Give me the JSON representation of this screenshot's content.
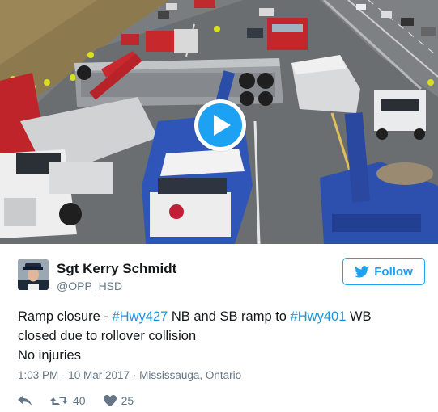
{
  "author": {
    "name": "Sgt Kerry Schmidt",
    "handle": "@OPP_HSD"
  },
  "follow_button": {
    "label": "Follow",
    "icon": "twitter-bird-icon"
  },
  "tweet": {
    "line1_prefix": "Ramp closure - ",
    "hashtag1": "#Hwy427",
    "line1_middle": " NB and SB ramp to ",
    "hashtag2": "#Hwy401",
    "line1_suffix": " WB",
    "line2": "closed due to rollover collision",
    "line3": "No injuries"
  },
  "meta": {
    "timestamp": "1:03 PM - 10 Mar 2017",
    "separator": " · ",
    "location": "Mississauga, Ontario"
  },
  "actions": {
    "reply_icon": "reply-icon",
    "retweet_icon": "retweet-icon",
    "retweet_count": "40",
    "like_icon": "heart-icon",
    "like_count": "25"
  },
  "media": {
    "type": "video",
    "play_icon": "play-icon"
  },
  "colors": {
    "accent": "#1da1f2",
    "hashtag": "#1b95e0",
    "secondary_text": "#657786",
    "primary_text": "#14171a"
  }
}
